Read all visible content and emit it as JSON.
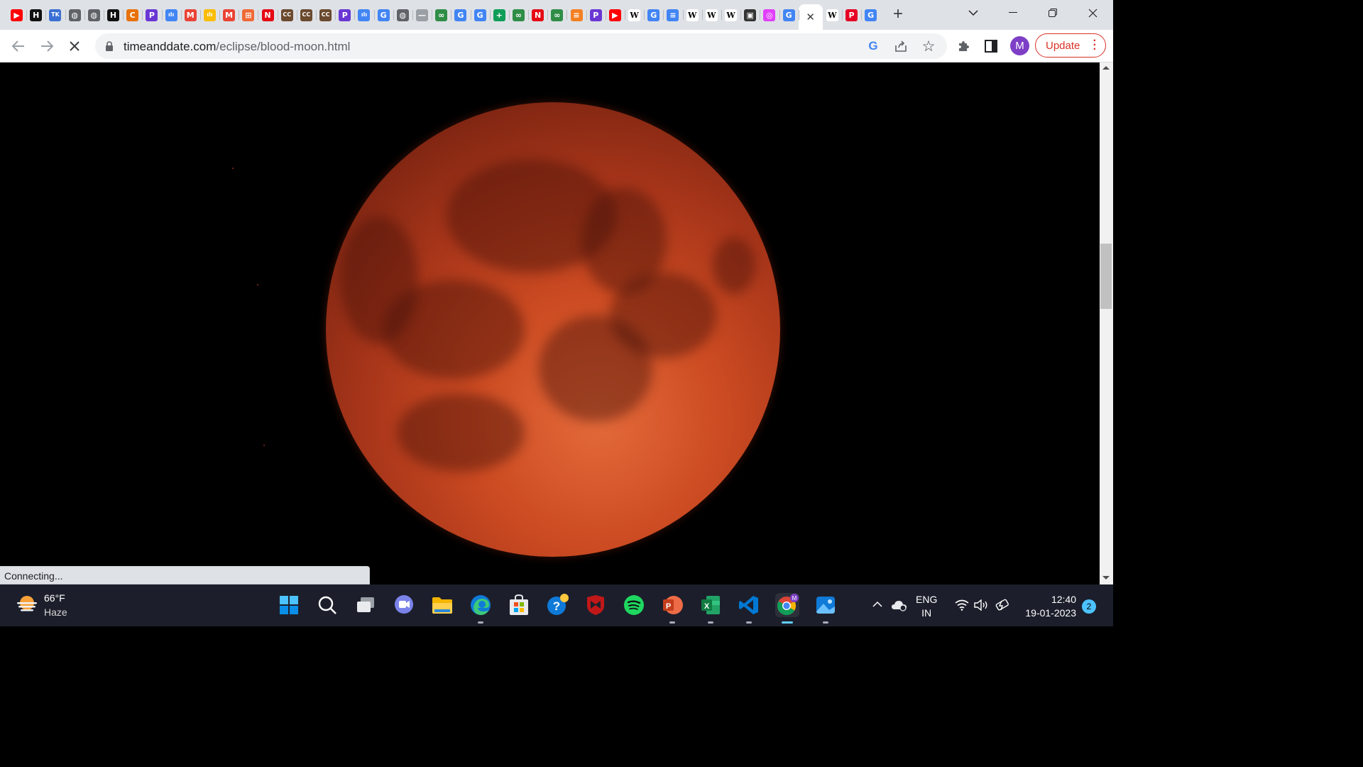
{
  "browser": {
    "tabs": [
      {
        "icon": "youtube-icon",
        "glyph": "▶",
        "bg": "#ff0000"
      },
      {
        "icon": "hindustan-times-icon",
        "glyph": "H",
        "bg": "#111111"
      },
      {
        "icon": "tk-icon",
        "glyph": "TK",
        "bg": "#3b6fd4"
      },
      {
        "icon": "globe-icon",
        "glyph": "◍",
        "bg": "#5f6368"
      },
      {
        "icon": "globe-icon",
        "glyph": "◍",
        "bg": "#5f6368"
      },
      {
        "icon": "hindustan-times-icon",
        "glyph": "H",
        "bg": "#111111"
      },
      {
        "icon": "c-icon",
        "glyph": "C",
        "bg": "#e8710a"
      },
      {
        "icon": "p-icon",
        "glyph": "P",
        "bg": "#6a37d4"
      },
      {
        "icon": "bar-chart-icon",
        "glyph": "ılı",
        "bg": "#4285f4"
      },
      {
        "icon": "gmail-icon",
        "glyph": "M",
        "bg": "#ea4335"
      },
      {
        "icon": "bar-chart-icon",
        "glyph": "ılı",
        "bg": "#fbbc04"
      },
      {
        "icon": "gmail-icon",
        "glyph": "M",
        "bg": "#ea4335"
      },
      {
        "icon": "grid-icon",
        "glyph": "⊞",
        "bg": "#f06a35"
      },
      {
        "icon": "netflix-icon",
        "glyph": "N",
        "bg": "#e50914"
      },
      {
        "icon": "cc-icon",
        "glyph": "CC",
        "bg": "#6b4a2e"
      },
      {
        "icon": "cc-icon",
        "glyph": "CC",
        "bg": "#6b4a2e"
      },
      {
        "icon": "cc-icon",
        "glyph": "CC",
        "bg": "#6b4a2e"
      },
      {
        "icon": "p-icon",
        "glyph": "P",
        "bg": "#6a37d4"
      },
      {
        "icon": "bar-chart-icon",
        "glyph": "ılı",
        "bg": "#4285f4"
      },
      {
        "icon": "google-icon",
        "glyph": "G",
        "bg": "#4285f4"
      },
      {
        "icon": "globe-icon",
        "glyph": "◍",
        "bg": "#5f6368"
      },
      {
        "icon": "dash-icon",
        "glyph": "—",
        "bg": "#9aa0a6"
      },
      {
        "icon": "geeksforgeeks-icon",
        "glyph": "∞",
        "bg": "#2f8d46"
      },
      {
        "icon": "google-icon",
        "glyph": "G",
        "bg": "#4285f4"
      },
      {
        "icon": "google-icon",
        "glyph": "G",
        "bg": "#4285f4"
      },
      {
        "icon": "plus-green-icon",
        "glyph": "+",
        "bg": "#0f9d58"
      },
      {
        "icon": "geeksforgeeks-icon",
        "glyph": "∞",
        "bg": "#2f8d46"
      },
      {
        "icon": "netflix-icon",
        "glyph": "N",
        "bg": "#e50914"
      },
      {
        "icon": "geeksforgeeks-icon",
        "glyph": "∞",
        "bg": "#2f8d46"
      },
      {
        "icon": "stackoverflow-icon",
        "glyph": "≡",
        "bg": "#f48024"
      },
      {
        "icon": "p-icon",
        "glyph": "P",
        "bg": "#6a37d4"
      },
      {
        "icon": "youtube-icon",
        "glyph": "▶",
        "bg": "#ff0000"
      },
      {
        "icon": "wikipedia-icon",
        "glyph": "W",
        "bg": "#ffffff"
      },
      {
        "icon": "google-icon",
        "glyph": "G",
        "bg": "#4285f4"
      },
      {
        "icon": "google-docs-icon",
        "glyph": "≡",
        "bg": "#4285f4"
      },
      {
        "icon": "wikipedia-icon",
        "glyph": "W",
        "bg": "#ffffff"
      },
      {
        "icon": "wikipedia-icon",
        "glyph": "W",
        "bg": "#ffffff"
      },
      {
        "icon": "wikipedia-icon",
        "glyph": "W",
        "bg": "#ffffff"
      },
      {
        "icon": "dark-app-icon",
        "glyph": "▣",
        "bg": "#333333"
      },
      {
        "icon": "color-wheel-icon",
        "glyph": "◎",
        "bg": "#e040fb"
      },
      {
        "icon": "google-icon",
        "glyph": "G",
        "bg": "#4285f4"
      },
      {
        "icon": "close-icon",
        "glyph": "✕",
        "bg": "",
        "active": true
      },
      {
        "icon": "wikipedia-icon",
        "glyph": "W",
        "bg": "#ffffff"
      },
      {
        "icon": "pinterest-icon",
        "glyph": "P",
        "bg": "#e60023"
      },
      {
        "icon": "google-icon",
        "glyph": "G",
        "bg": "#4285f4"
      }
    ],
    "new_tab_glyph": "+",
    "window_controls": {
      "tab_search": "⌄",
      "minimize": "—",
      "restore": "❐",
      "close": "✕"
    },
    "nav": {
      "back": "←",
      "forward": "→",
      "stop": "✕"
    },
    "url_domain": "timeanddate.com",
    "url_path": "/eclipse/blood-moon.html",
    "actions": {
      "google_lens": "G",
      "share": "⇪",
      "bookmark": "☆",
      "extensions": "🧩",
      "side_panel": "◧"
    },
    "avatar_letter": "M",
    "update_label": "Update",
    "status_text": "Connecting..."
  },
  "page": {
    "image_alt": "blood moon"
  },
  "taskbar": {
    "weather": {
      "temp": "66°F",
      "condition": "Haze"
    },
    "apps": [
      {
        "name": "start-button",
        "running": false
      },
      {
        "name": "search-button",
        "running": false
      },
      {
        "name": "task-view-button",
        "running": false
      },
      {
        "name": "chat-button",
        "running": false
      },
      {
        "name": "file-explorer-button",
        "running": false
      },
      {
        "name": "edge-button",
        "running": true
      },
      {
        "name": "microsoft-store-button",
        "running": false
      },
      {
        "name": "get-help-button",
        "running": false
      },
      {
        "name": "mcafee-button",
        "running": false
      },
      {
        "name": "spotify-button",
        "running": false
      },
      {
        "name": "powerpoint-button",
        "running": true
      },
      {
        "name": "excel-button",
        "running": true
      },
      {
        "name": "vscode-button",
        "running": true
      },
      {
        "name": "chrome-button",
        "running": true,
        "focused": true
      },
      {
        "name": "photos-button",
        "running": true
      }
    ],
    "tray": {
      "chevron": "^",
      "lang_line1": "ENG",
      "lang_line2": "IN"
    },
    "clock": {
      "time": "12:40",
      "date": "19-01-2023"
    },
    "notification_count": "2"
  },
  "colors": {
    "chrome_frame": "#dee1e6",
    "update_red": "#d93025",
    "taskbar": "#1c1f2b",
    "moon_red": "#c0431d"
  }
}
